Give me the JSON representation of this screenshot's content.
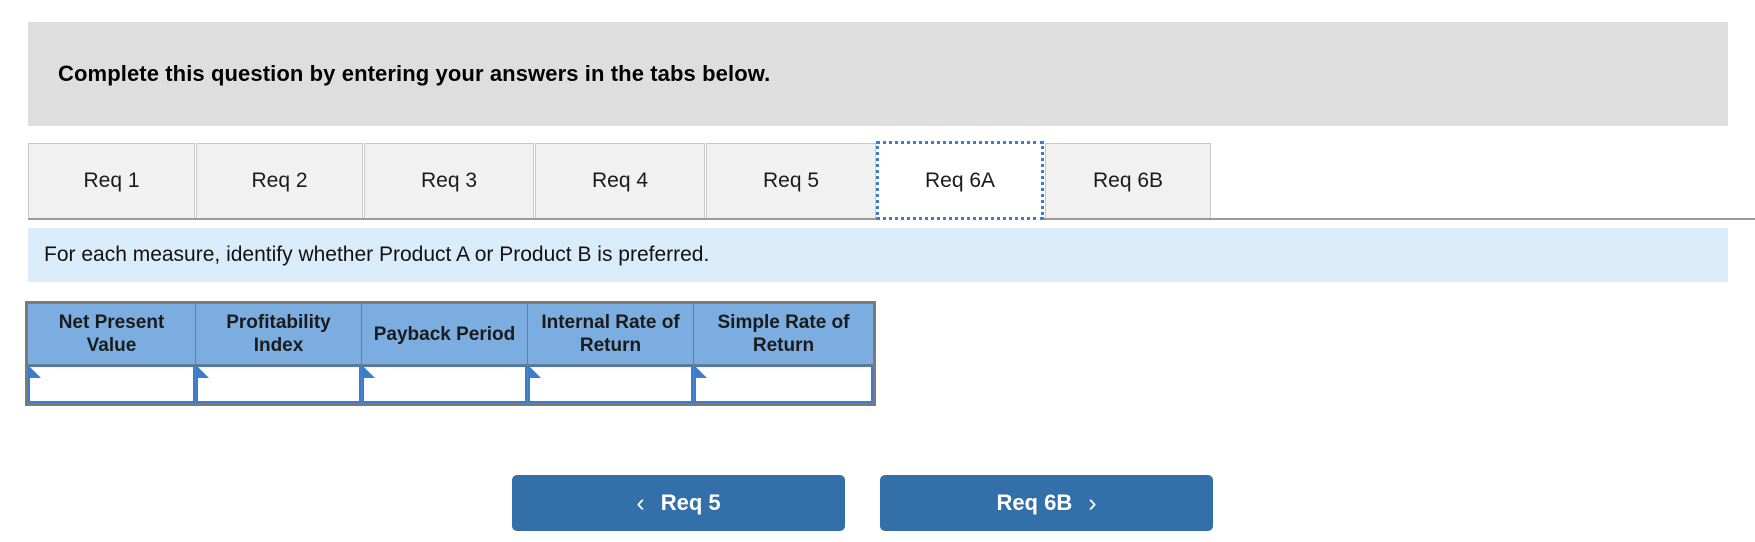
{
  "banner": {
    "text": "Complete this question by entering your answers in the tabs below."
  },
  "tabs": {
    "items": [
      {
        "label": "Req 1",
        "selected": false
      },
      {
        "label": "Req 2",
        "selected": false
      },
      {
        "label": "Req 3",
        "selected": false
      },
      {
        "label": "Req 4",
        "selected": false
      },
      {
        "label": "Req 5",
        "selected": false
      },
      {
        "label": "Req 6A",
        "selected": true
      },
      {
        "label": "Req 6B",
        "selected": false
      }
    ]
  },
  "instruction": {
    "text": "For each measure, identify whether Product A or Product B is preferred."
  },
  "answer_table": {
    "headers": [
      "Net Present Value",
      "Profitability Index",
      "Payback Period",
      "Internal Rate of Return",
      "Simple Rate of Return"
    ],
    "values": [
      "",
      "",
      "",
      "",
      ""
    ]
  },
  "navigation": {
    "prev_label": "Req 5",
    "prev_icon": "chevron-left-icon",
    "prev_chevron": "‹",
    "next_label": "Req 6B",
    "next_icon": "chevron-right-icon",
    "next_chevron": "›"
  },
  "colors": {
    "banner_bg": "#dedede",
    "instruction_bg": "#daecf9",
    "table_header_bg": "#7bade0",
    "accent_blue": "#3d7cc9",
    "button_blue": "#336fa8",
    "tab_bg": "#f1f1f1"
  }
}
